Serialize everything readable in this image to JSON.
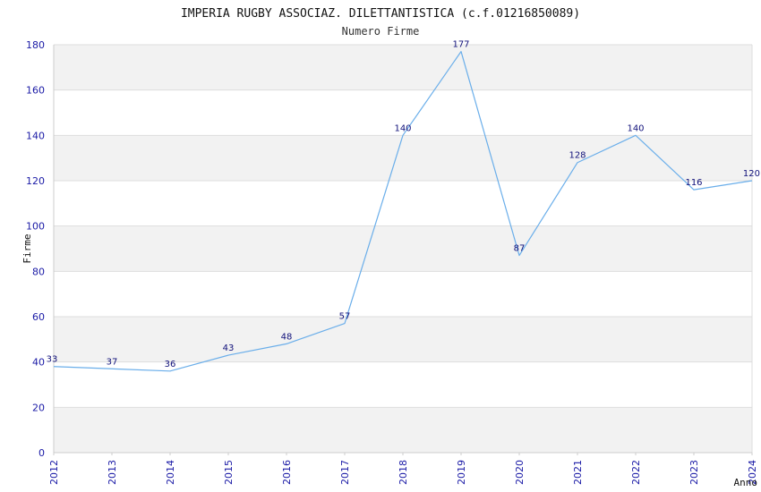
{
  "chart_data": {
    "type": "line",
    "title": "IMPERIA RUGBY ASSOCIAZ. DILETTANTISTICA (c.f.01216850089)",
    "subtitle": "Numero Firme",
    "xlabel": "Anno",
    "ylabel": "Firme",
    "x": [
      "2012",
      "2013",
      "2014",
      "2015",
      "2016",
      "2017",
      "2018",
      "2019",
      "2020",
      "2021",
      "2022",
      "2023",
      "2024"
    ],
    "y_values": [
      38,
      37,
      36,
      43,
      48,
      57,
      140,
      177,
      87,
      128,
      140,
      116,
      120
    ],
    "data_labels": [
      "33",
      "37",
      "36",
      "43",
      "48",
      "57",
      "140",
      "177",
      "87",
      "128",
      "140",
      "116",
      "120"
    ],
    "ylim": [
      0,
      180
    ],
    "yticks": [
      0,
      20,
      40,
      60,
      80,
      100,
      120,
      140,
      160,
      180
    ],
    "grid": "horizontal, alternating bands",
    "legend": "none",
    "colors": {
      "line": "#6aaeea",
      "band": "#f2f2f2",
      "grid": "#dddddd",
      "tick_text": "#1a1aa6",
      "label_text": "#10107a"
    }
  }
}
